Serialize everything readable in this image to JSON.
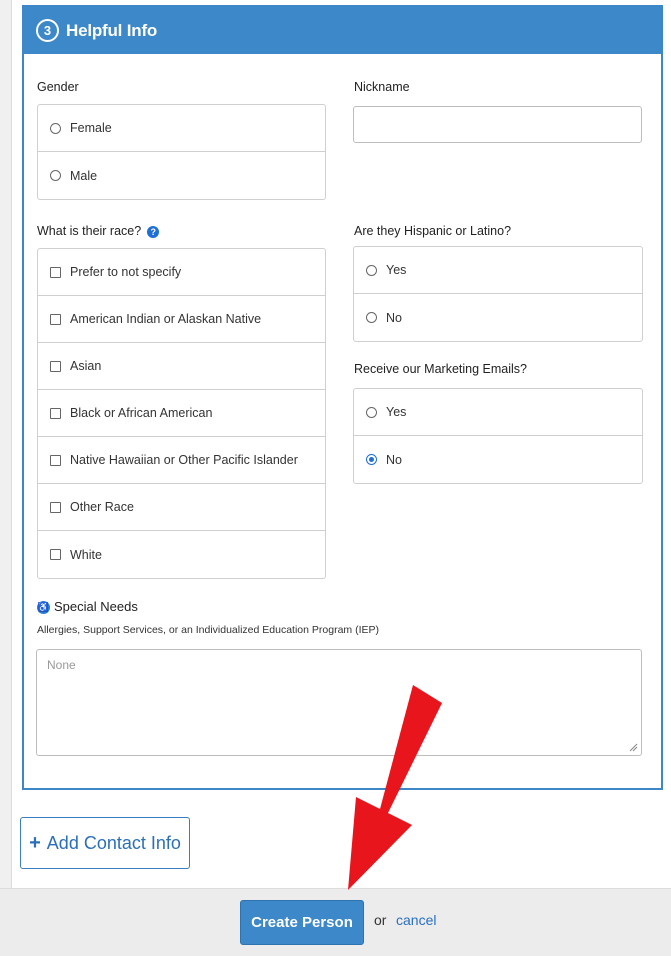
{
  "section": {
    "step_number": "3",
    "title": "Helpful Info"
  },
  "gender": {
    "label": "Gender",
    "options": [
      "Female",
      "Male"
    ]
  },
  "nickname": {
    "label": "Nickname",
    "value": ""
  },
  "race": {
    "label": "What is their race?",
    "help_icon": "question-circle-icon",
    "options": [
      "Prefer to not specify",
      "American Indian or Alaskan Native",
      "Asian",
      "Black or African American",
      "Native Hawaiian or Other Pacific Islander",
      "Other Race",
      "White"
    ]
  },
  "hispanic": {
    "label": "Are they Hispanic or Latino?",
    "options": [
      "Yes",
      "No"
    ]
  },
  "marketing": {
    "label": "Receive our Marketing Emails?",
    "options": [
      "Yes",
      "No"
    ],
    "selected": "No"
  },
  "special_needs": {
    "icon": "accessibility-icon",
    "label": "Special Needs",
    "help_text": "Allergies, Support Services, or an Individualized Education Program (IEP)",
    "placeholder": "None"
  },
  "actions": {
    "add_contact_label": "Add Contact Info",
    "add_contact_icon": "+",
    "create_label": "Create Person",
    "or_text": "or",
    "cancel_label": "cancel"
  },
  "colors": {
    "header_blue": "#3d88c9",
    "annotation_red": "#e8161c",
    "link_blue": "#2a6fc0"
  }
}
